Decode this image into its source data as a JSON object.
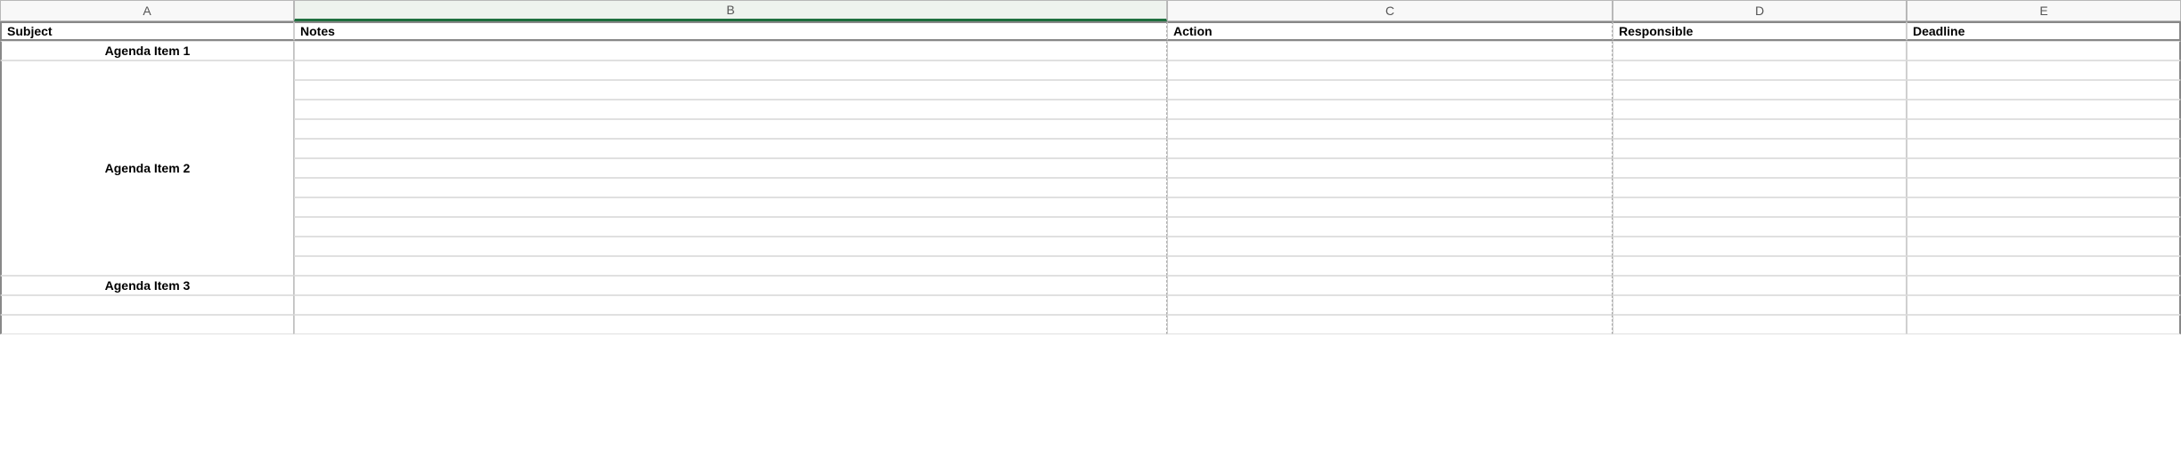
{
  "columnLetters": {
    "a": "A",
    "b": "B",
    "c": "C",
    "d": "D",
    "e": "E"
  },
  "headers": {
    "subject": "Subject",
    "notes": "Notes",
    "action": "Action",
    "responsible": "Responsible",
    "deadline": "Deadline"
  },
  "agenda": {
    "item1": "Agenda Item 1",
    "item2": "Agenda Item 2",
    "item3": "Agenda Item 3"
  },
  "selectedColumn": "B"
}
